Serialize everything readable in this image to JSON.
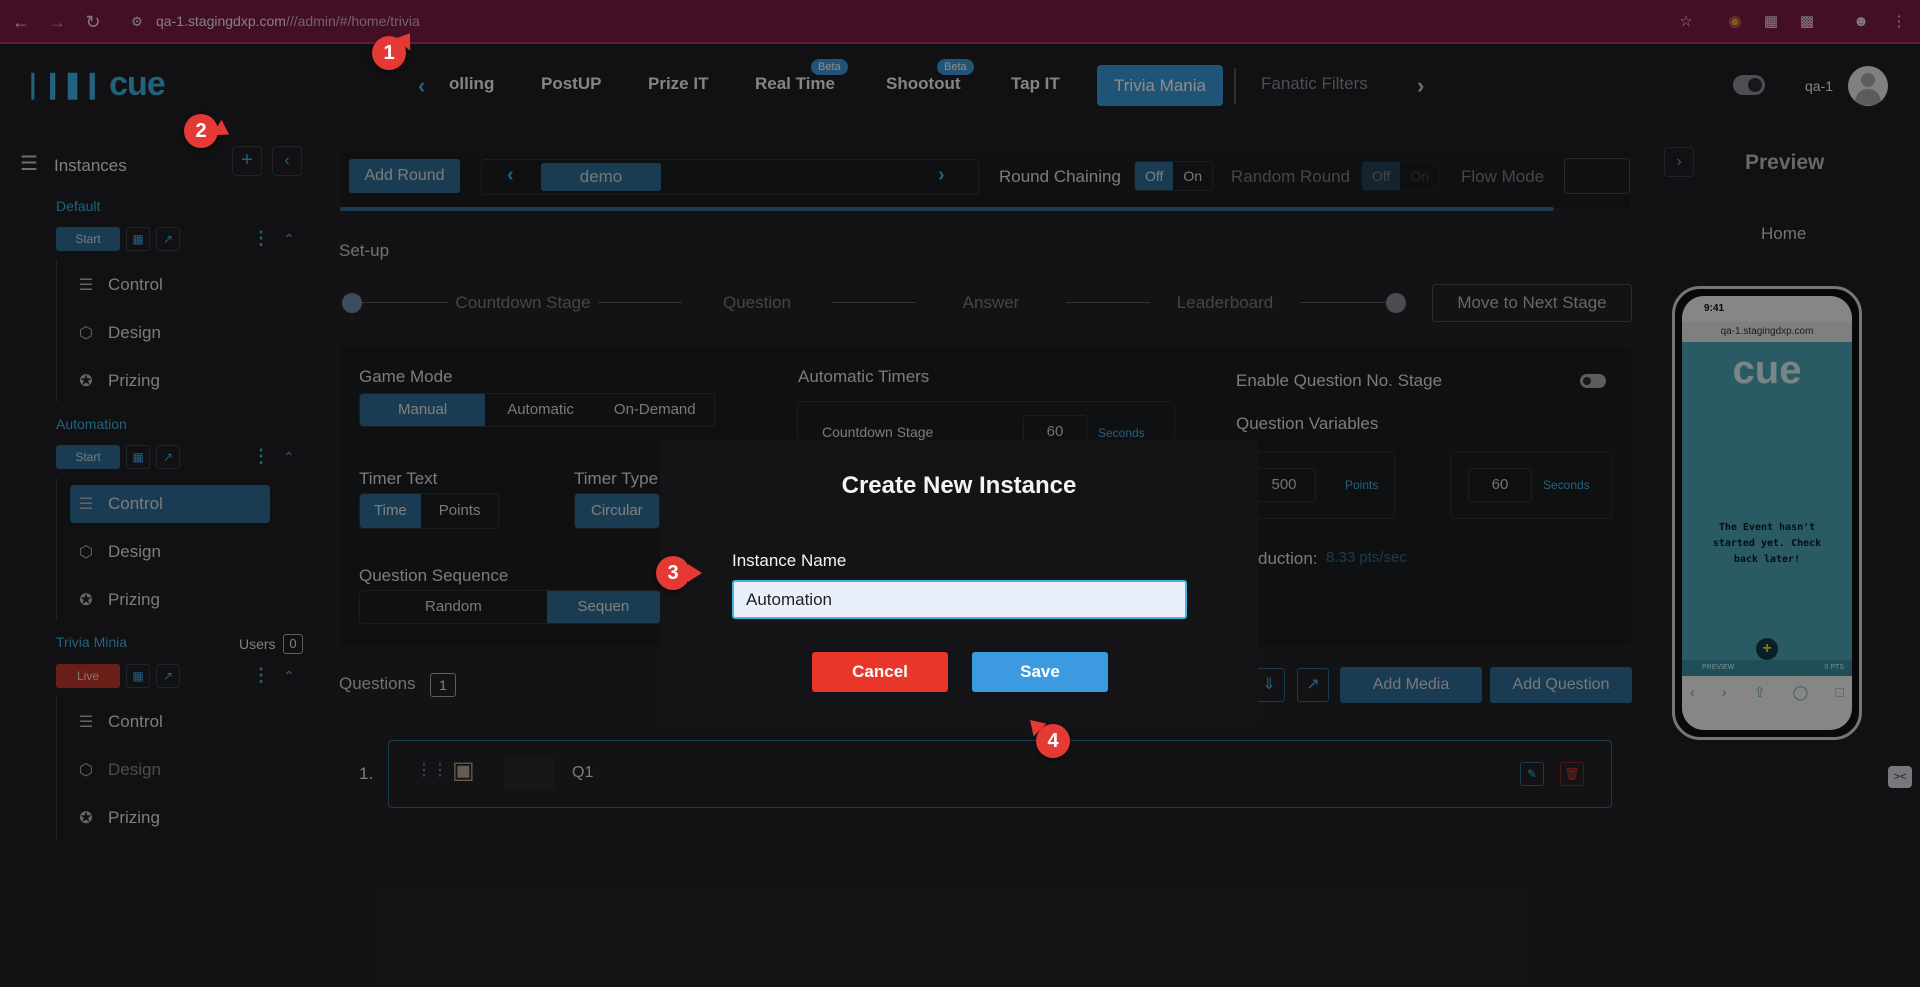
{
  "browser": {
    "url_host": "qa-1.stagingdxp.com",
    "url_path": "///admin/#/home/trivia"
  },
  "header": {
    "logo_text": "cue",
    "nav_items": [
      {
        "label": "olling"
      },
      {
        "label": "PostUP"
      },
      {
        "label": "Prize IT"
      },
      {
        "label": "Real Time",
        "badge": "Beta"
      },
      {
        "label": "Shootout",
        "badge": "Beta"
      },
      {
        "label": "Tap IT"
      },
      {
        "label": "Trivia Mania",
        "active": true
      },
      {
        "label": "Fanatic Filters"
      }
    ],
    "username": "qa-1"
  },
  "sidebar": {
    "title": "Instances",
    "groups": [
      {
        "name": "Default",
        "status": "Start",
        "status_color": "#2f6d96",
        "items": [
          "Control",
          "Design",
          "Prizing"
        ]
      },
      {
        "name": "Automation",
        "status": "Start",
        "status_color": "#2f6d96",
        "items": [
          "Control",
          "Design",
          "Prizing"
        ],
        "active_item": "Control"
      },
      {
        "name": "Trivia Minia",
        "status": "Live",
        "status_color": "#c0392b",
        "users_label": "Users",
        "users_count": "0",
        "items": [
          "Control",
          "Design",
          "Prizing"
        ]
      }
    ]
  },
  "main": {
    "add_round": "Add Round",
    "round_name": "demo",
    "round_chaining": "Round Chaining",
    "off": "Off",
    "on": "On",
    "random_round": "Random Round",
    "flow_mode": "Flow Mode",
    "setup": "Set-up",
    "stages": [
      "Countdown Stage",
      "Question",
      "Answer",
      "Leaderboard"
    ],
    "move_next": "Move to Next Stage",
    "game_mode": {
      "label": "Game Mode",
      "options": [
        "Manual",
        "Automatic",
        "On-Demand"
      ],
      "selected": "Manual"
    },
    "automatic_timers": "Automatic Timers",
    "countdown_stage": "Countdown Stage",
    "countdown_value": "60",
    "seconds": "Seconds",
    "enable_qno": "Enable Question No. Stage",
    "question_variables": "Question Variables",
    "points_value": "500",
    "points": "Points",
    "seconds_value": "60",
    "deduction_label": "duction:",
    "deduction_value": "8.33 pts/sec",
    "timer_text": {
      "label": "Timer Text",
      "options": [
        "Time",
        "Points"
      ],
      "selected": "Time"
    },
    "timer_type": {
      "label": "Timer Type",
      "selected": "Circular"
    },
    "question_sequence": {
      "label": "Question Sequence",
      "options": [
        "Random",
        "Sequen"
      ],
      "selected": "Sequen"
    },
    "questions_label": "Questions",
    "questions_count": "1",
    "add_media": "Add Media",
    "add_question": "Add Question",
    "question_row": {
      "index": "1.",
      "title": "Q1"
    }
  },
  "modal": {
    "title": "Create New Instance",
    "field_label": "Instance Name",
    "field_value": "Automation",
    "cancel": "Cancel",
    "save": "Save"
  },
  "preview": {
    "title": "Preview",
    "page": "Home",
    "phone_time": "9:41",
    "phone_url": "qa-1.stagingdxp.com",
    "phone_logo": "cue",
    "phone_message": "The Event hasn't started yet. Check back later!",
    "phone_preview_label": "PREVIEW",
    "phone_pts": "0 PTS"
  },
  "annotations": [
    "1",
    "2",
    "3",
    "4"
  ],
  "colors": {
    "accent": "#3fb3e8",
    "primary": "#2f6d96",
    "danger": "#e8362a",
    "save": "#3c9be0",
    "browser": "#7a1c47"
  }
}
